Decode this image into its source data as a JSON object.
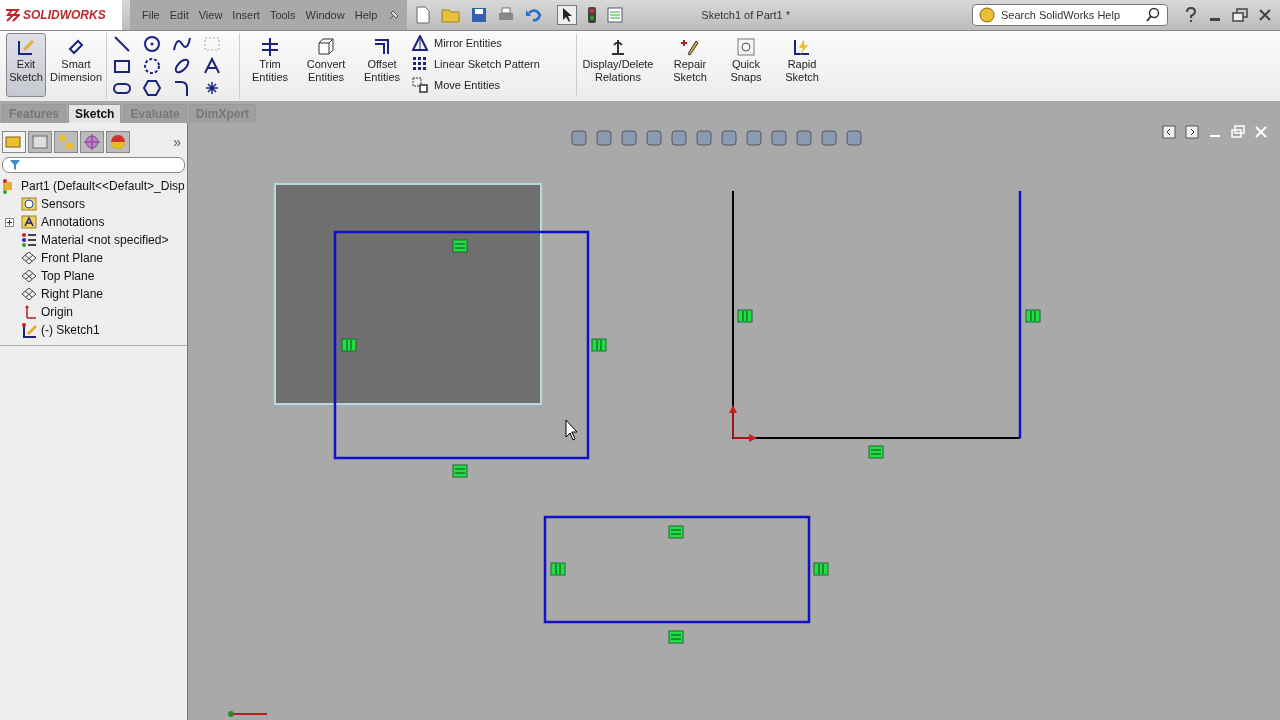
{
  "app": {
    "logo": "SOLIDWORKS"
  },
  "menu": [
    "File",
    "Edit",
    "View",
    "Insert",
    "Tools",
    "Window",
    "Help"
  ],
  "document_title": "Sketch1 of Part1 *",
  "search": {
    "placeholder": "Search SolidWorks Help"
  },
  "commands": [
    {
      "label": "Exit Sketch",
      "kind": "exit",
      "selected": true
    },
    {
      "label": "Smart Dimension",
      "kind": "dimension",
      "selected": false
    },
    {
      "kind": "tools"
    },
    {
      "label": "Trim Entities",
      "kind": "trim",
      "selected": false
    },
    {
      "label": "Convert Entities",
      "kind": "convert",
      "selected": false
    },
    {
      "label": "Offset Entities",
      "kind": "offset",
      "selected": false
    },
    {
      "kind": "list",
      "items": [
        {
          "label": "Mirror Entities",
          "kind": "mirror"
        },
        {
          "label": "Linear Sketch Pattern",
          "kind": "pattern"
        },
        {
          "label": "Move Entities",
          "kind": "move"
        }
      ]
    },
    {
      "label": "Display/Delete Relations",
      "kind": "relations",
      "selected": false
    },
    {
      "label": "Repair Sketch",
      "kind": "repair",
      "selected": false
    },
    {
      "label": "Quick Snaps",
      "kind": "snaps",
      "selected": false
    },
    {
      "label": "Rapid Sketch",
      "kind": "rapid",
      "selected": false
    }
  ],
  "panel_chevron": "»",
  "tabs": [
    {
      "label": "Features",
      "selected": false
    },
    {
      "label": "Sketch",
      "selected": true
    },
    {
      "label": "Evaluate",
      "selected": false
    },
    {
      "label": "DimXpert",
      "selected": false
    }
  ],
  "tree": {
    "label": "Part1  (Default<<Default>_Disp",
    "kind": "part",
    "children": [
      {
        "label": "Sensors",
        "kind": "sensors"
      },
      {
        "label": "Annotations",
        "kind": "annotations",
        "expanded": false
      },
      {
        "label": "Material <not specified>",
        "kind": "material"
      },
      {
        "label": "Front Plane",
        "kind": "plane"
      },
      {
        "label": "Top Plane",
        "kind": "plane"
      },
      {
        "label": "Right Plane",
        "kind": "plane"
      },
      {
        "label": "Origin",
        "kind": "origin"
      },
      {
        "label": "(-) Sketch1",
        "kind": "sketch"
      }
    ]
  }
}
